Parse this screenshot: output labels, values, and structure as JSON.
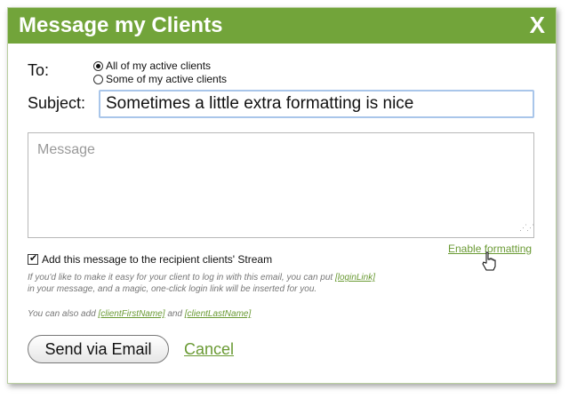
{
  "dialog": {
    "title": "Message my Clients",
    "close_label": "X"
  },
  "to": {
    "label": "To:",
    "options": [
      {
        "label": "All of my active clients",
        "selected": true
      },
      {
        "label": "Some of my active clients",
        "selected": false
      }
    ]
  },
  "subject": {
    "label": "Subject:",
    "value": "Sometimes a little extra formatting is nice"
  },
  "message": {
    "placeholder": "Message"
  },
  "enable_formatting_label": "Enable formatting",
  "stream_checkbox": {
    "label": "Add this message to the recipient clients' Stream",
    "checked": true
  },
  "help": {
    "login_line1": "If you'd like to make it easy for your client to log in with this email, you can put",
    "login_token": "[loginLink]",
    "login_line2": "in your message, and a magic, one-click login link will be inserted for you.",
    "names_prefix": "You can also add",
    "first_name_token": "[clientFirstName]",
    "names_and": "and",
    "last_name_token": "[clientLastName]"
  },
  "actions": {
    "send_label": "Send via Email",
    "cancel_label": "Cancel"
  },
  "colors": {
    "titlebar": "#72a43a",
    "link": "#6a9a34",
    "input_border": "#a9c6ea"
  }
}
